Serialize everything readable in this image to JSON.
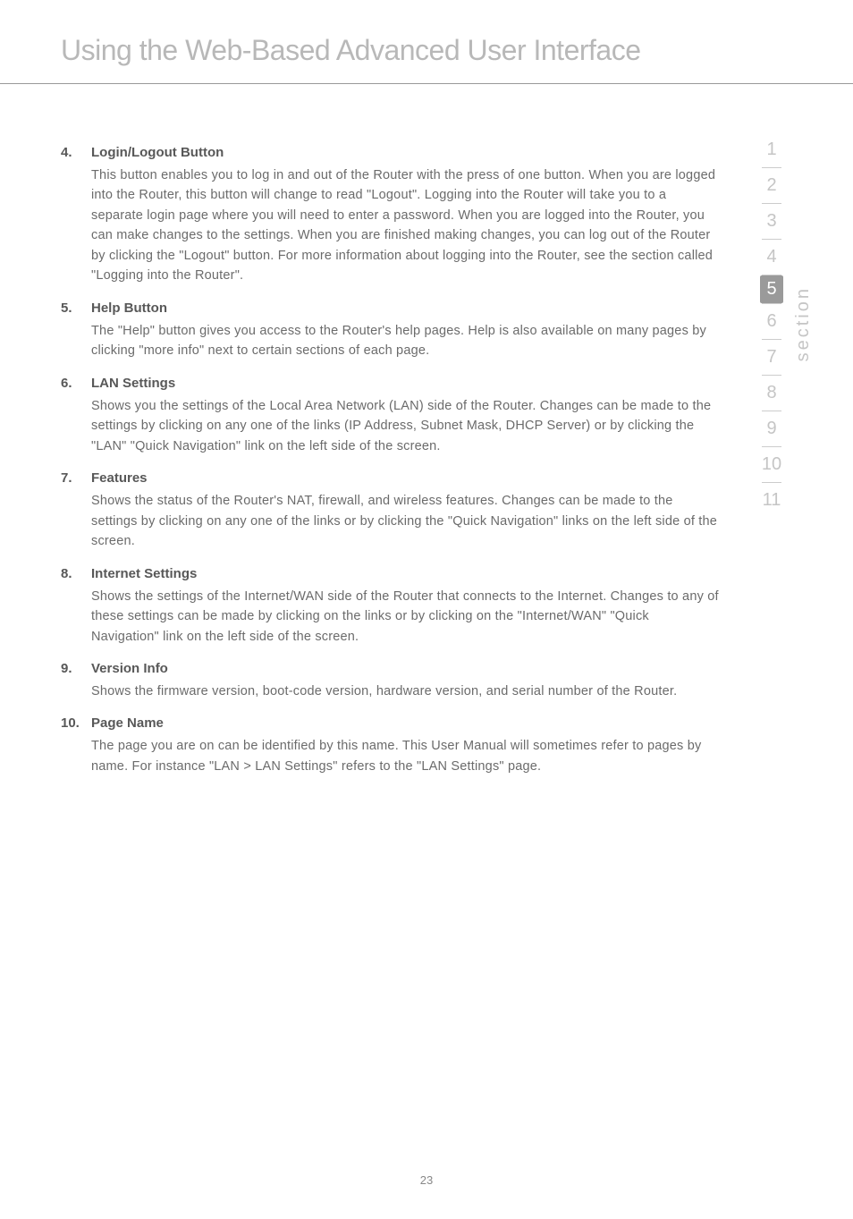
{
  "page_title": "Using the Web-Based Advanced User Interface",
  "items": [
    {
      "number": "4.",
      "heading": "Login/Logout Button",
      "text": "This button enables you to log in and out of the Router with the press of one button. When you are logged into the Router, this button will change to read \"Logout\". Logging into the Router will take you to a separate login page where you will need to enter a password. When you are logged into the Router, you can make changes to the settings. When you are finished making changes, you can log out of the Router by clicking the \"Logout\" button. For more information about logging into the Router, see the section called \"Logging into the Router\"."
    },
    {
      "number": "5.",
      "heading": "Help Button",
      "text": "The \"Help\" button gives you access to the Router's help pages. Help is also available on many pages by clicking \"more info\" next to certain sections of each page."
    },
    {
      "number": "6.",
      "heading": "LAN Settings",
      "text": "Shows you the settings of the Local Area Network (LAN) side of the Router. Changes can be made to the settings by clicking on any one of the links (IP Address, Subnet Mask, DHCP Server) or by clicking the \"LAN\" \"Quick Navigation\" link on the left side of the screen."
    },
    {
      "number": "7.",
      "heading": "Features",
      "text": "Shows the status of the Router's NAT, firewall, and wireless features. Changes can be made to the settings by clicking on any one of the links or by clicking the \"Quick Navigation\" links on the left side of the screen."
    },
    {
      "number": "8.",
      "heading": "Internet Settings",
      "text": "Shows the settings of the Internet/WAN side of the Router that connects to the Internet. Changes to any of these settings can be made by clicking on the links or by clicking on the \"Internet/WAN\" \"Quick Navigation\" link on the left side of the screen."
    },
    {
      "number": "9.",
      "heading": "Version Info",
      "text": "Shows the firmware version, boot-code version, hardware version, and serial number of the Router."
    },
    {
      "number": "10.",
      "heading": "Page Name",
      "text": "The page you are on can be identified by this name. This User Manual will sometimes refer to pages by name. For instance \"LAN > LAN Settings\" refers to the \"LAN Settings\" page."
    }
  ],
  "sidebar": {
    "label": "section",
    "tabs": [
      "1",
      "2",
      "3",
      "4",
      "5",
      "6",
      "7",
      "8",
      "9",
      "10",
      "11"
    ],
    "active": "5"
  },
  "page_number": "23"
}
